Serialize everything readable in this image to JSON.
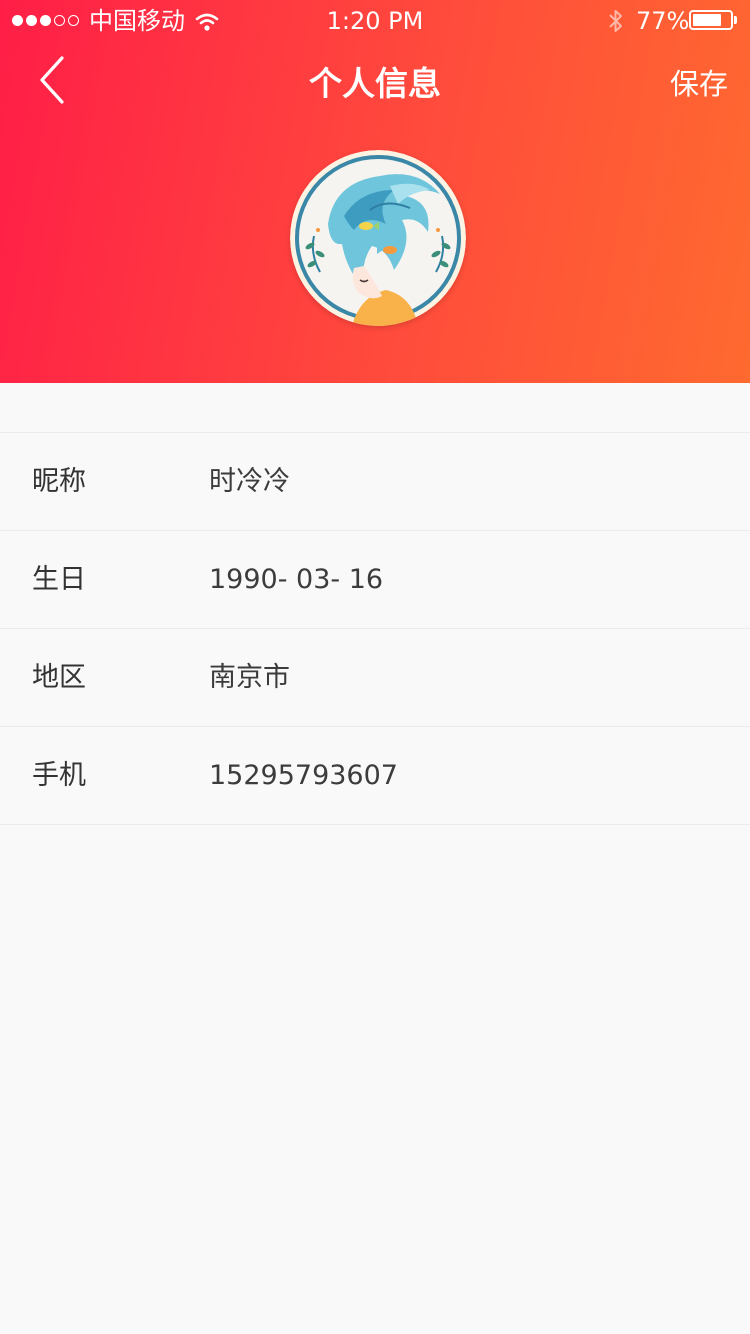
{
  "status_bar": {
    "carrier": "中国移动",
    "time": "1:20 PM",
    "battery": "77%",
    "battery_level": 0.77,
    "signal_strength": 3,
    "signal_max": 5
  },
  "nav": {
    "title": "个人信息",
    "save_label": "保存"
  },
  "profile": {
    "rows": [
      {
        "label": "昵称",
        "value": "时冷冷"
      },
      {
        "label": "生日",
        "value": "1990- 03- 16"
      },
      {
        "label": "地区",
        "value": "南京市"
      },
      {
        "label": "手机",
        "value": "15295793607"
      }
    ]
  },
  "colors": {
    "header_gradient_start": "#ff1e47",
    "header_gradient_end": "#ff6a2f",
    "background": "#f9f9f9",
    "divider": "#ececec"
  },
  "icons": {
    "back": "chevron-left-icon",
    "wifi": "wifi-icon",
    "bluetooth": "bluetooth-icon",
    "battery": "battery-icon"
  }
}
